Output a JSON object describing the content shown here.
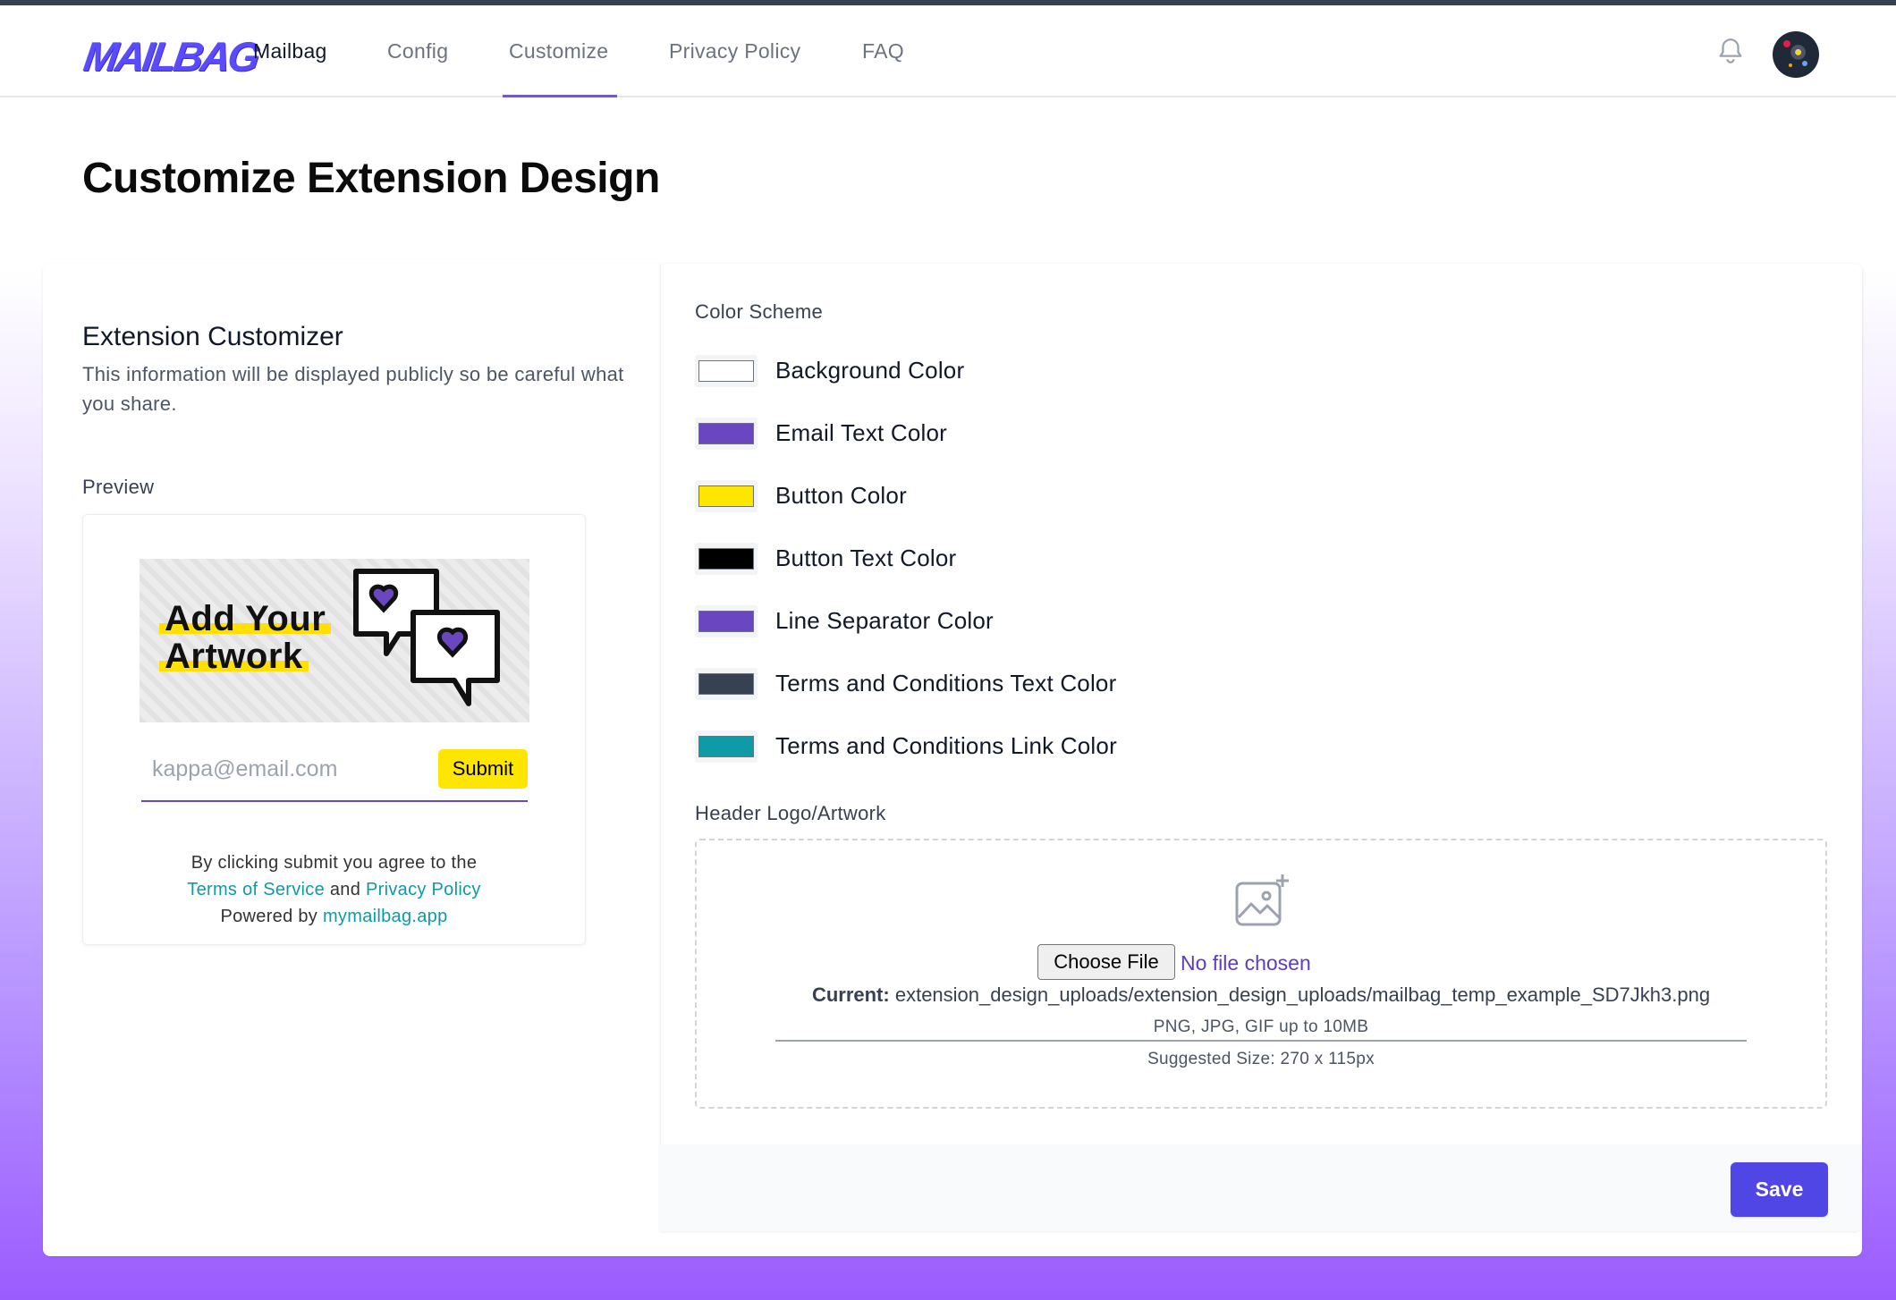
{
  "nav": {
    "logo": "MAILBAG",
    "links": [
      {
        "label": "Mailbag"
      },
      {
        "label": "Config"
      },
      {
        "label": "Customize"
      },
      {
        "label": "Privacy Policy"
      },
      {
        "label": "FAQ"
      }
    ],
    "active": "Customize",
    "icons": {
      "notifications": "bell-icon",
      "profile": "avatar"
    }
  },
  "page": {
    "title": "Customize Extension Design"
  },
  "customizer": {
    "title": "Extension Customizer",
    "description": "This information will be displayed publicly so be careful what you share.",
    "preview_label": "Preview"
  },
  "preview": {
    "artwork_line1": "Add Your",
    "artwork_line2": "Artwork",
    "email_placeholder": "kappa@email.com",
    "submit_label": "Submit",
    "terms_prefix": "By clicking submit you agree to the",
    "terms_link": "Terms of Service",
    "terms_and": "and",
    "privacy_link": "Privacy Policy",
    "powered_prefix": "Powered by",
    "powered_link": "mymailbag.app"
  },
  "color_scheme": {
    "label": "Color Scheme",
    "items": [
      {
        "label": "Background Color",
        "color": "#ffffff"
      },
      {
        "label": "Email Text Color",
        "color": "#6b46c1"
      },
      {
        "label": "Button Color",
        "color": "#ffe600"
      },
      {
        "label": "Button Text Color",
        "color": "#000000"
      },
      {
        "label": "Line Separator Color",
        "color": "#6b46c1"
      },
      {
        "label": "Terms and Conditions Text Color",
        "color": "#374151"
      },
      {
        "label": "Terms and Conditions Link Color",
        "color": "#0e9aa7"
      }
    ]
  },
  "upload": {
    "label": "Header Logo/Artwork",
    "choose_label": "Choose File",
    "no_file": "No file chosen",
    "current_label": "Current:",
    "current_value": "extension_design_uploads/extension_design_uploads/mailbag_temp_example_SD7Jkh3.png",
    "formats": "PNG, JPG, GIF up to 10MB",
    "suggested": "Suggested Size: 270 x 115px"
  },
  "actions": {
    "save_label": "Save"
  },
  "colors": {
    "accent": "#4f46e5",
    "brand": "#5b4bff"
  }
}
